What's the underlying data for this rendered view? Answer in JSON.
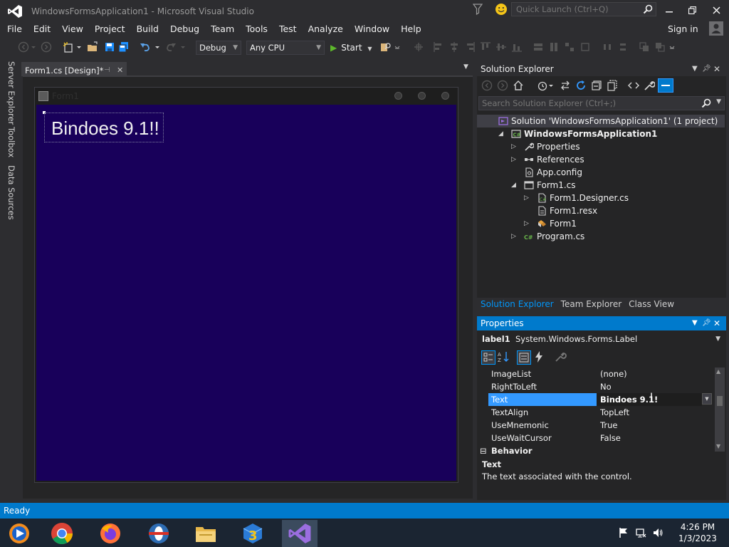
{
  "window": {
    "title": "WindowsFormsApplication1 - Microsoft Visual Studio",
    "quick_launch_placeholder": "Quick Launch (Ctrl+Q)",
    "sign_in": "Sign in"
  },
  "menu": [
    "File",
    "Edit",
    "View",
    "Project",
    "Build",
    "Debug",
    "Team",
    "Tools",
    "Test",
    "Analyze",
    "Window",
    "Help"
  ],
  "toolbar": {
    "configuration": "Debug",
    "platform": "Any CPU",
    "start": "Start"
  },
  "side_tabs": [
    "Server Explorer",
    "Toolbox",
    "Data Sources"
  ],
  "document": {
    "tab_label": "Form1.cs [Design]*",
    "form_title": "Form1",
    "label_text": "Bindoes 9.1!!",
    "form_bg": "#18005a"
  },
  "solution_explorer": {
    "title": "Solution Explorer",
    "search_placeholder": "Search Solution Explorer (Ctrl+;)",
    "tree": [
      {
        "label": "Solution 'WindowsFormsApplication1' (1 project)",
        "level": 0,
        "expander": "",
        "icon": "solution-icon",
        "bold": false,
        "selected": true
      },
      {
        "label": "WindowsFormsApplication1",
        "level": 1,
        "expander": "expanded",
        "icon": "csharp-project-icon",
        "bold": true,
        "selected": false
      },
      {
        "label": "Properties",
        "level": 2,
        "expander": "collapsed",
        "icon": "wrench-icon",
        "bold": false,
        "selected": false
      },
      {
        "label": "References",
        "level": 2,
        "expander": "collapsed",
        "icon": "references-icon",
        "bold": false,
        "selected": false
      },
      {
        "label": "App.config",
        "level": 2,
        "expander": "",
        "icon": "config-file-icon",
        "bold": false,
        "selected": false
      },
      {
        "label": "Form1.cs",
        "level": 2,
        "expander": "expanded",
        "icon": "form-file-icon",
        "bold": false,
        "selected": false
      },
      {
        "label": "Form1.Designer.cs",
        "level": 3,
        "expander": "collapsed",
        "icon": "cs-file-icon",
        "bold": false,
        "selected": false
      },
      {
        "label": "Form1.resx",
        "level": 3,
        "expander": "",
        "icon": "resx-file-icon",
        "bold": false,
        "selected": false
      },
      {
        "label": "Form1",
        "level": 3,
        "expander": "collapsed",
        "icon": "class-icon",
        "bold": false,
        "selected": false
      },
      {
        "label": "Program.cs",
        "level": 2,
        "expander": "collapsed",
        "icon": "csharp-file-icon",
        "bold": false,
        "selected": false
      }
    ],
    "tabs": [
      "Solution Explorer",
      "Team Explorer",
      "Class View"
    ],
    "active_tab": 0
  },
  "properties": {
    "title": "Properties",
    "object_name": "label1",
    "object_type": "System.Windows.Forms.Label",
    "rows": [
      {
        "name": "ImageList",
        "value": "(none)",
        "selected": false
      },
      {
        "name": "RightToLeft",
        "value": "No",
        "selected": false
      },
      {
        "name": "Text",
        "value": "Bindoes 9.1!",
        "selected": true
      },
      {
        "name": "TextAlign",
        "value": "TopLeft",
        "selected": false
      },
      {
        "name": "UseMnemonic",
        "value": "True",
        "selected": false
      },
      {
        "name": "UseWaitCursor",
        "value": "False",
        "selected": false
      }
    ],
    "category": "Behavior",
    "description_title": "Text",
    "description": "The text associated with the control."
  },
  "status": "Ready",
  "taskbar": {
    "apps": [
      "Windows Media Player",
      "Chrome",
      "Firefox",
      "Opera",
      "File Explorer",
      "App 3",
      "Visual Studio"
    ],
    "active_app": 6,
    "time": "4:26 PM",
    "date": "1/3/2023"
  },
  "colors": {
    "accent": "#007acc",
    "ide_bg": "#2d2d30",
    "status_bar": "#007acc",
    "selection": "#3399ff"
  }
}
